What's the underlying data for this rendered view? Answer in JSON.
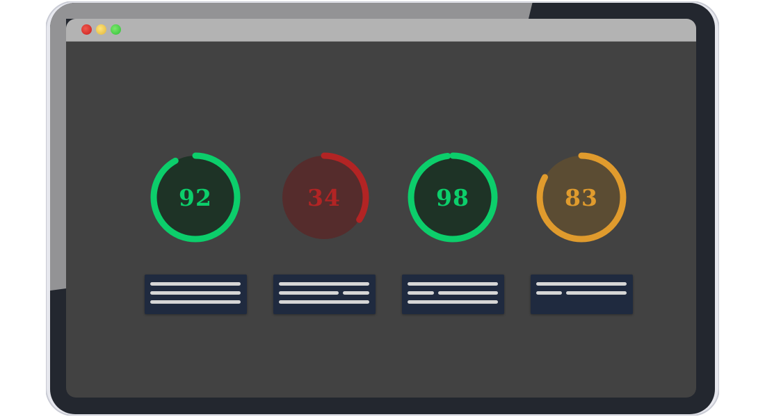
{
  "window": {
    "controls": [
      "close",
      "minimize",
      "maximize"
    ],
    "colors": {
      "close": "#d92d25",
      "minimize": "#f2c94c",
      "maximize": "#4cd45a"
    }
  },
  "gauges": [
    {
      "score": "92",
      "fraction": 0.92,
      "status": "pass",
      "color": "#0cce6b",
      "fill": "#1e3326"
    },
    {
      "score": "34",
      "fraction": 0.34,
      "status": "fail",
      "color": "#b22424",
      "fill": "#552c2c"
    },
    {
      "score": "98",
      "fraction": 0.98,
      "status": "pass",
      "color": "#0cce6b",
      "fill": "#1e3326"
    },
    {
      "score": "83",
      "fraction": 0.83,
      "status": "average",
      "color": "#e09b2d",
      "fill": "#5b4c33"
    }
  ],
  "colors": {
    "screen_bg": "#424242",
    "card_bg": "#1f2a3f",
    "placeholder_line": "#d6d6d6"
  }
}
